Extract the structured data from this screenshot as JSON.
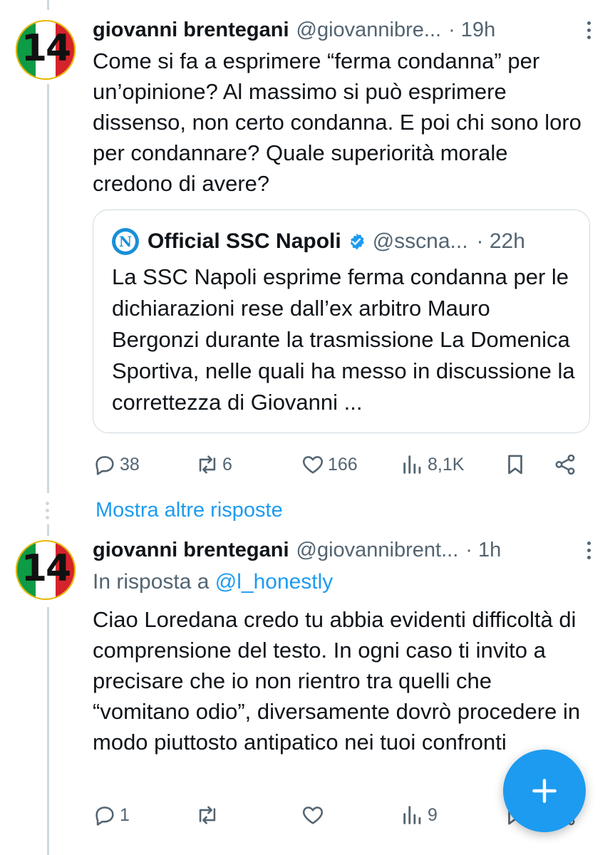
{
  "tweet1": {
    "avatar_text": "14",
    "name": "giovanni brentegani",
    "handle": "@giovannibre...",
    "time": "· 19h",
    "text": "Come si fa a esprimere “ferma condanna” per un’opinione? Al massimo si può esprimere dissenso, non certo condanna. E poi chi sono loro per condannare? Quale superiorità morale credono di avere?",
    "quote": {
      "logo_letter": "N",
      "name": "Official SSC Napoli",
      "handle": "@sscna...",
      "time": "· 22h",
      "text": "La SSC Napoli esprime ferma condanna per le dichiarazioni rese dall’ex arbitro Mauro Bergonzi durante la trasmissione La Domenica Sportiva, nelle quali ha messo in discussione la correttezza di Giovanni ..."
    },
    "actions": {
      "replies": "38",
      "reposts": "6",
      "likes": "166",
      "views": "8,1K"
    }
  },
  "show_more": "Mostra altre risposte",
  "tweet2": {
    "avatar_text": "14",
    "name": "giovanni brentegani",
    "handle": "@giovannibrent...",
    "time": "· 1h",
    "reply_prefix": "In risposta a",
    "reply_mention": "@l_honestly",
    "text": "Ciao Loredana credo tu abbia evidenti difficoltà di comprensione del testo. In ogni caso ti invito a precisare che io non rientro tra quelli che “vomitano odio”, diversamente dovrò procedere in modo piuttosto antipatico nei tuoi confronti",
    "actions": {
      "replies": "1",
      "views": "9"
    }
  },
  "colors": {
    "accent": "#1d9bf0",
    "text": "#0f1419",
    "secondary": "#536471",
    "border": "#cfd9de"
  },
  "icons": [
    "reply-icon",
    "repost-icon",
    "like-icon",
    "views-icon",
    "bookmark-icon",
    "share-icon",
    "more-icon",
    "verified-icon",
    "compose-plus-icon"
  ]
}
